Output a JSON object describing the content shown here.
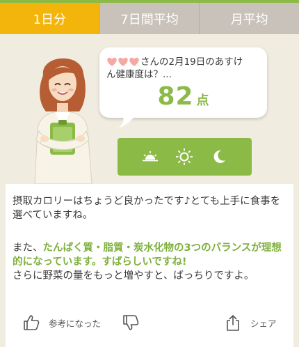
{
  "tabs": [
    {
      "label": "1日分",
      "active": true
    },
    {
      "label": "7日間平均",
      "active": false
    },
    {
      "label": "月平均",
      "active": false
    }
  ],
  "bubble": {
    "line1_suffix": "さんの2月19日のあすけ",
    "line2": "ん健康度は？...",
    "score": "82",
    "score_unit": "点"
  },
  "time_icons": [
    "sunrise-icon",
    "sun-icon",
    "moon-icon"
  ],
  "advice": {
    "para1": "摂取カロリーはちょうど良かったです♪とても上手に食事を選べていますね。",
    "para2_prefix": "また、",
    "para2_highlight": "たんぱく質・脂質・炭水化物の3つのバランスが理想的になっています。すばらしいですね!",
    "para2_suffix": "さらに野菜の量をもっと増やすと、ばっちりですよ。"
  },
  "actions": {
    "helpful_label": "参考になった",
    "share_label": "シェア"
  },
  "colors": {
    "accent_green": "#8cba47",
    "tab_active": "#f3b40c",
    "tab_inactive": "#c9c2ba",
    "background": "#f1ece0"
  }
}
